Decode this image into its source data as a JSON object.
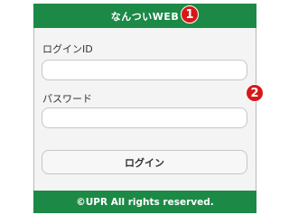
{
  "header": {
    "title": "なんついWEB"
  },
  "form": {
    "login_id_label": "ログインID",
    "login_id_value": "",
    "password_label": "パスワード",
    "password_value": "",
    "login_button_label": "ログイン"
  },
  "footer": {
    "copyright": "©UPR All rights reserved."
  },
  "annotations": [
    {
      "number": "1"
    },
    {
      "number": "2"
    }
  ],
  "colors": {
    "header_bg": "#1c8a46",
    "badge_bg": "#d71818"
  }
}
